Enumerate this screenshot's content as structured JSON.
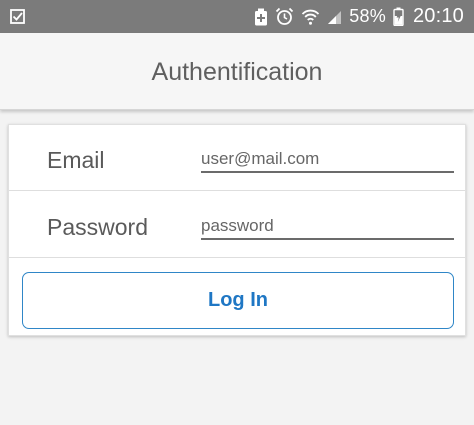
{
  "status_bar": {
    "left_icon": "checkbox-notification-icon",
    "icons": [
      "battery-saver-icon",
      "alarm-icon",
      "wifi-icon",
      "signal-icon"
    ],
    "battery_percent": "58%",
    "battery_icon": "battery-charging-icon",
    "time": "20:10"
  },
  "app_bar": {
    "title": "Authentification"
  },
  "form": {
    "email_label": "Email",
    "email_placeholder": "user@mail.com",
    "password_label": "Password",
    "password_placeholder": "password",
    "login_label": "Log In"
  },
  "colors": {
    "status_bar": "#7b7b7b",
    "app_bar": "#f6f6f6",
    "accent": "#1f77c4",
    "background": "#f3f3f3"
  }
}
